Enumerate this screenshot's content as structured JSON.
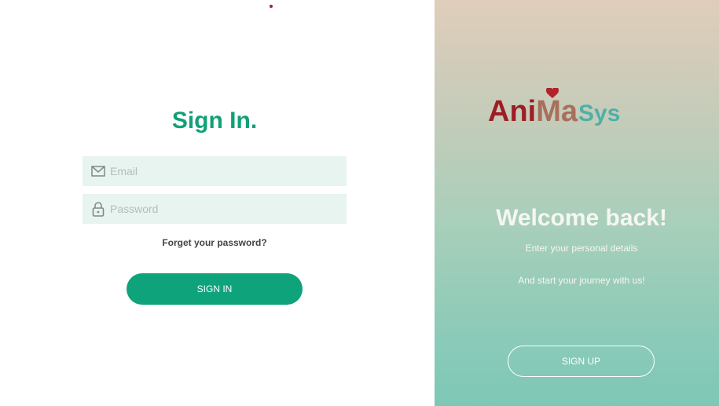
{
  "signin": {
    "title": "Sign In.",
    "email_placeholder": "Email",
    "password_placeholder": "Password",
    "forget_password": "Forget your password?",
    "button_label": "SIGN IN"
  },
  "welcome": {
    "logo": {
      "part1": "Ani",
      "part2": "Ma",
      "part3": "Sys"
    },
    "title": "Welcome back!",
    "line1": "Enter your personal details",
    "line2": "And start your journey with us!",
    "button_label": "SIGN UP"
  },
  "icons": {
    "email": "envelope-icon",
    "password": "lock-icon",
    "logo_heart": "heart-icon"
  },
  "colors": {
    "accent": "#0ea37b",
    "title_green": "#11a077",
    "field_bg": "#e7f4f0",
    "logo_red": "#9e1d25",
    "logo_brown": "#a86f5c",
    "logo_teal": "#4fb0a6"
  }
}
